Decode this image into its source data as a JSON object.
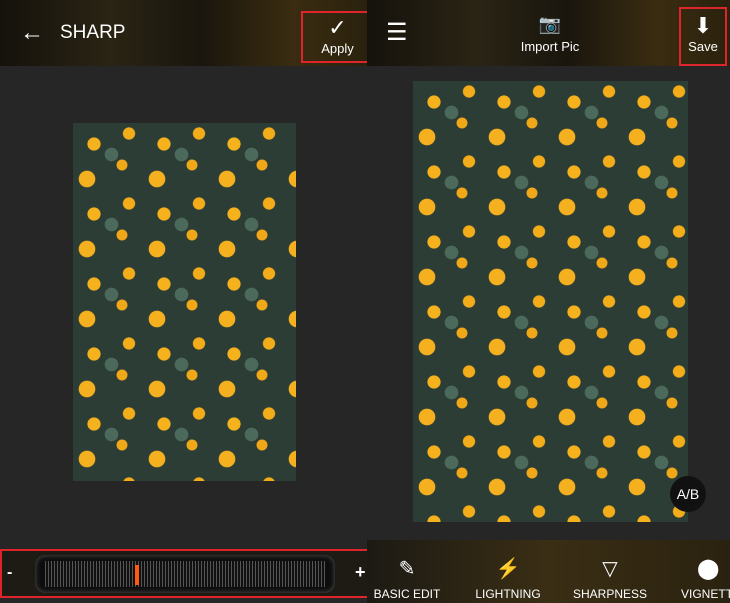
{
  "left": {
    "title": "SHARP",
    "apply_label": "Apply",
    "slider": {
      "minus": "-",
      "plus": "+",
      "value_percent": 32
    }
  },
  "right": {
    "import_label": "Import Pic",
    "save_label": "Save",
    "ab_label": "A/B",
    "tools": [
      {
        "label": "BASIC EDIT",
        "icon": "edit-icon"
      },
      {
        "label": "LIGHTNING",
        "icon": "lightning-icon"
      },
      {
        "label": "SHARPNESS",
        "icon": "sharpness-icon"
      },
      {
        "label": "VIGNETTE",
        "icon": "vignette-icon"
      }
    ]
  },
  "colors": {
    "highlight": "#e0242b",
    "slider_marker": "#ff5a10"
  }
}
